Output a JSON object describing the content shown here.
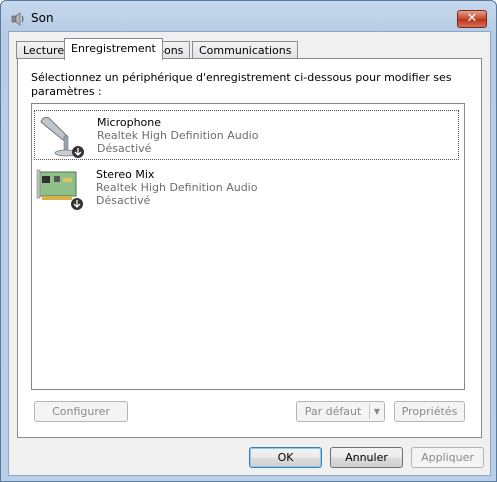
{
  "window": {
    "title": "Son",
    "close_label": "✕"
  },
  "tabs": [
    {
      "label": "Lecture",
      "active": false
    },
    {
      "label": "Enregistrement",
      "active": true
    },
    {
      "label": "Sons",
      "active": false
    },
    {
      "label": "Communications",
      "active": false
    }
  ],
  "instructions": "Sélectionnez un périphérique d'enregistrement ci-dessous pour modifier ses paramètres :",
  "devices": [
    {
      "name": "Microphone",
      "driver": "Realtek High Definition Audio",
      "status": "Désactivé",
      "icon": "microphone-icon",
      "selected": true
    },
    {
      "name": "Stereo Mix",
      "driver": "Realtek High Definition Audio",
      "status": "Désactivé",
      "icon": "sound-card-icon",
      "selected": false
    }
  ],
  "buttons": {
    "configure": {
      "label": "Configurer",
      "mnemonic": "C",
      "enabled": false
    },
    "set_default": {
      "label": "Par défaut",
      "mnemonic": "d",
      "enabled": false
    },
    "properties": {
      "label": "Propriétés",
      "mnemonic": "P",
      "enabled": false
    },
    "ok": {
      "label": "OK",
      "enabled": true
    },
    "cancel": {
      "label": "Annuler",
      "enabled": true
    },
    "apply": {
      "label": "Appliquer",
      "mnemonic": "A",
      "enabled": false
    }
  }
}
